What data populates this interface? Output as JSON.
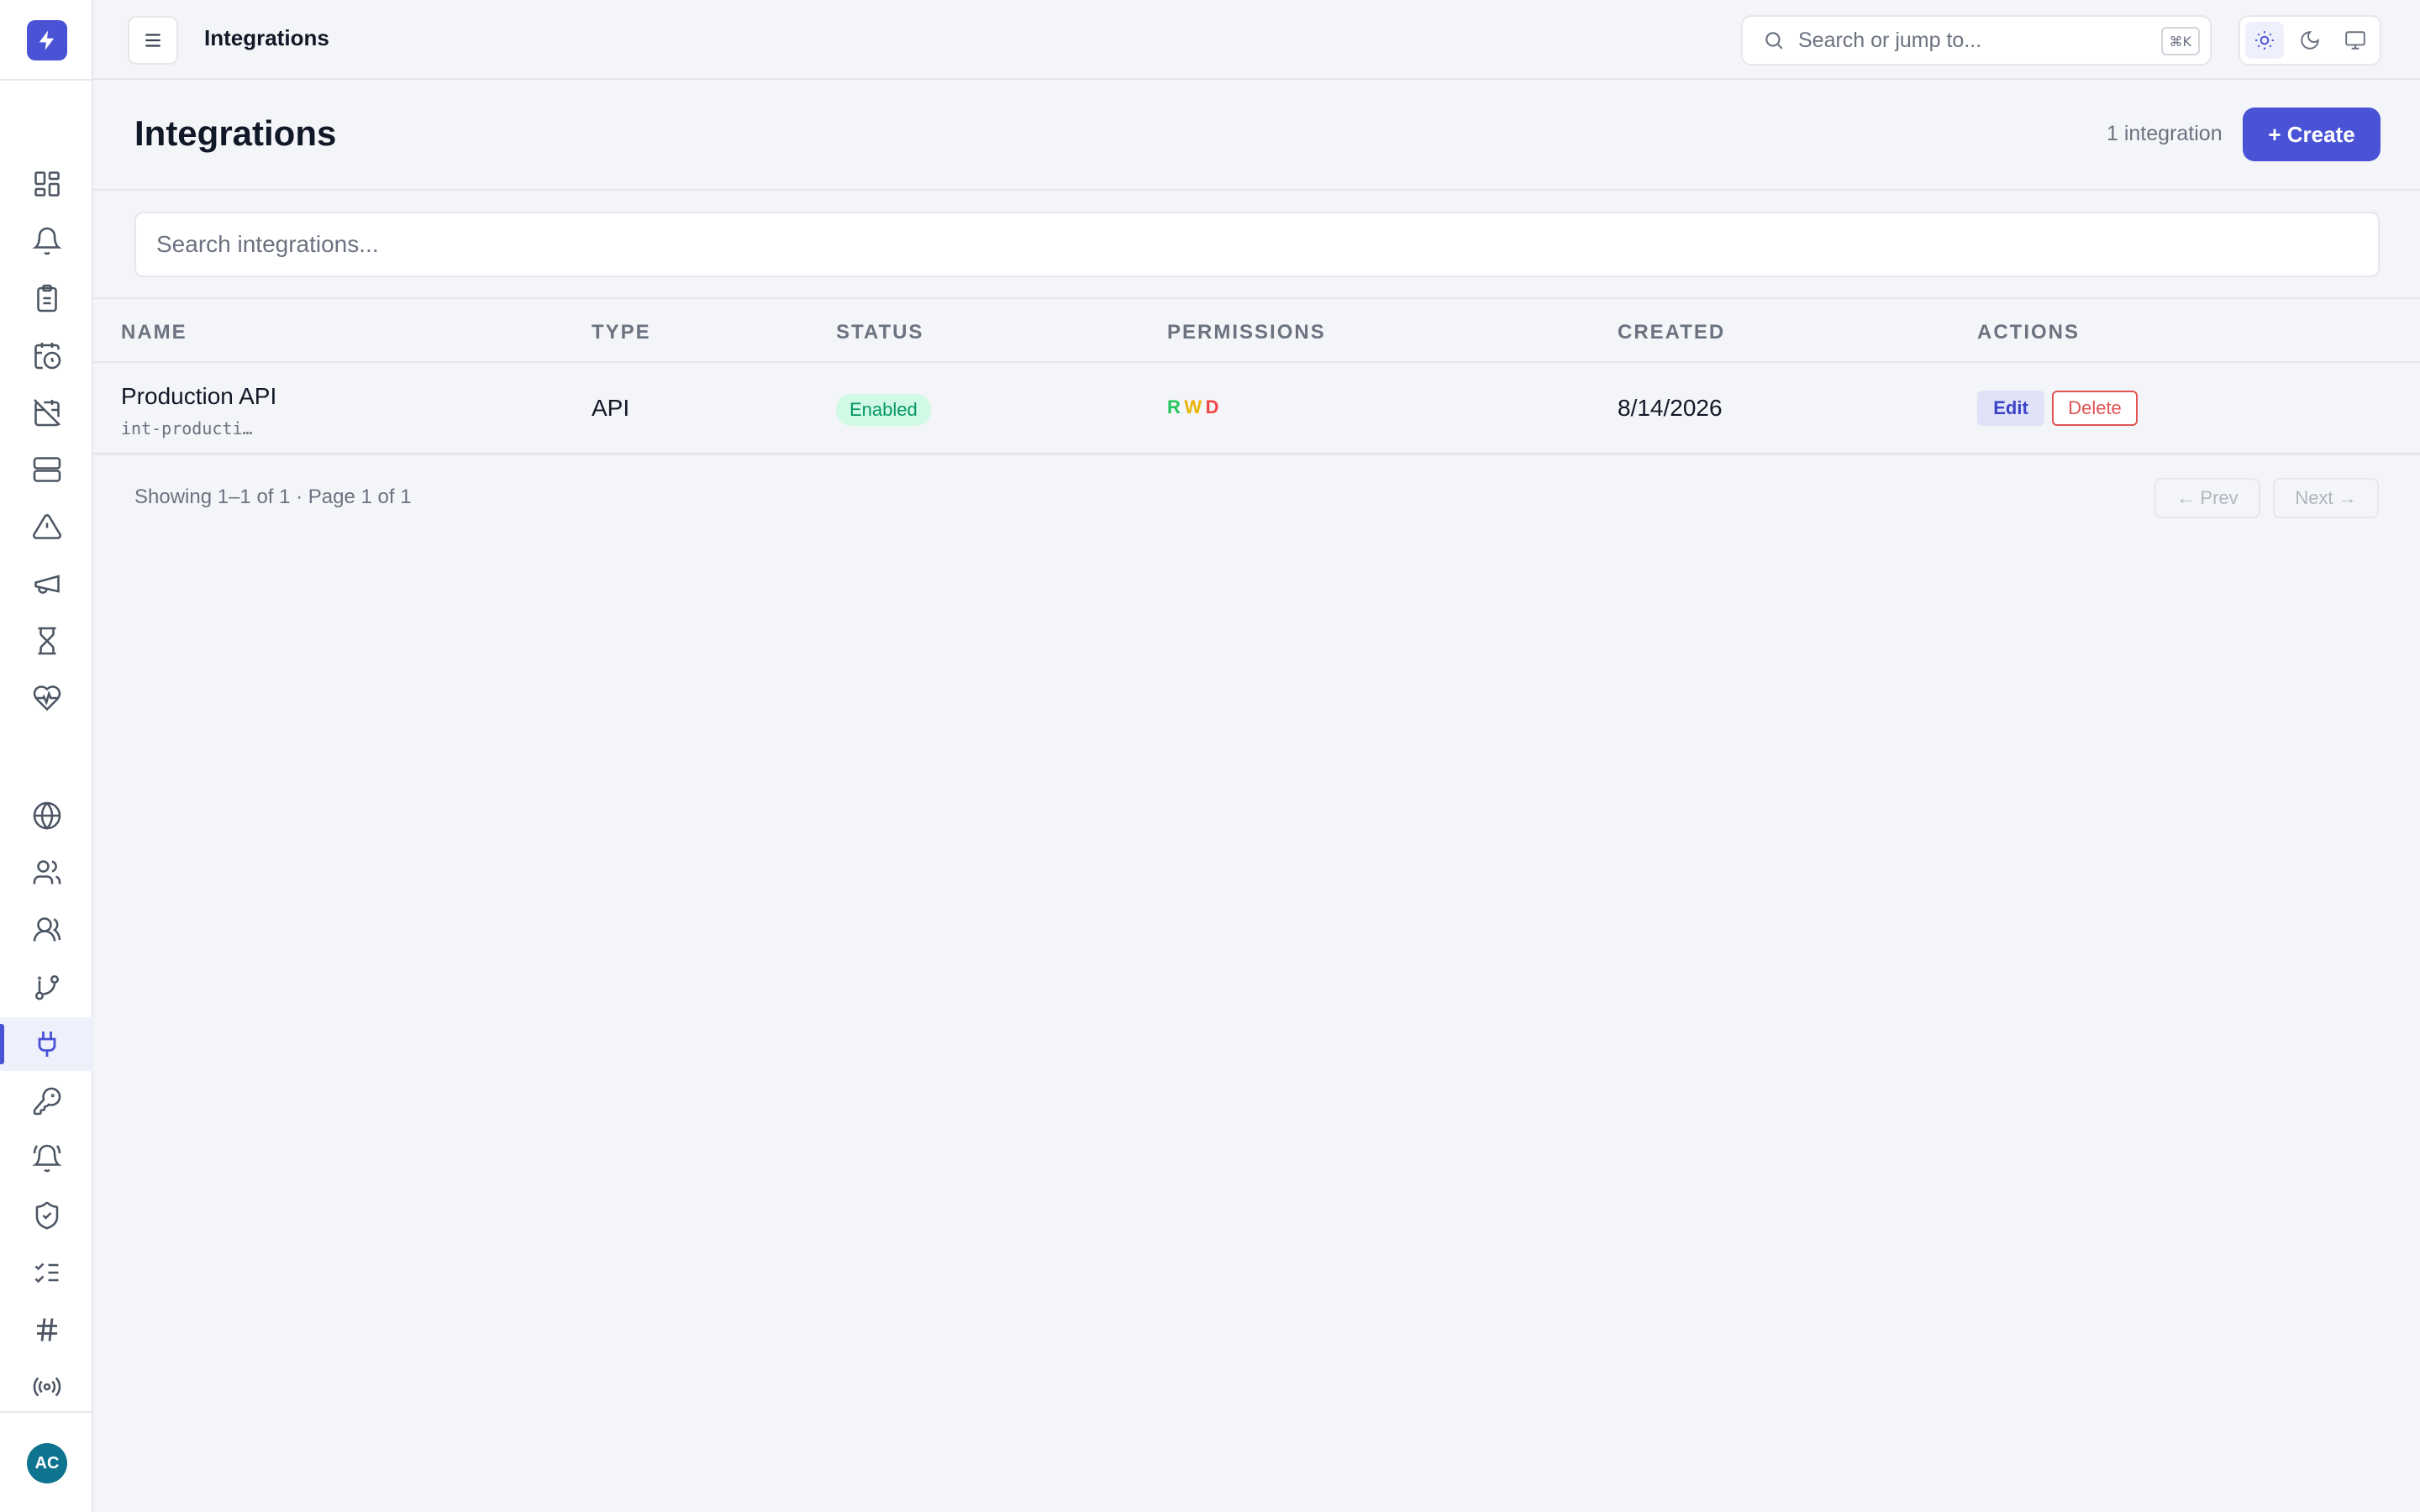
{
  "topbar": {
    "title": "Integrations",
    "search_placeholder": "Search or jump to...",
    "search_shortcut": "⌘K"
  },
  "sidebar": {
    "items": [
      {
        "icon": "dashboard-icon"
      },
      {
        "icon": "bell-icon"
      },
      {
        "icon": "clipboard-icon"
      },
      {
        "icon": "calendar-clock-icon"
      },
      {
        "icon": "calendar-off-icon"
      },
      {
        "icon": "server-icon"
      },
      {
        "icon": "alert-triangle-icon"
      },
      {
        "icon": "megaphone-icon"
      },
      {
        "icon": "hourglass-icon"
      },
      {
        "icon": "heart-pulse-icon"
      },
      {
        "icon": "globe-icon"
      },
      {
        "icon": "users-icon"
      },
      {
        "icon": "team-icon"
      },
      {
        "icon": "git-branch-icon"
      },
      {
        "icon": "plug-icon",
        "active": true
      },
      {
        "icon": "key-icon"
      },
      {
        "icon": "bell-ring-icon"
      },
      {
        "icon": "shield-check-icon"
      },
      {
        "icon": "list-checks-icon"
      },
      {
        "icon": "hash-icon"
      },
      {
        "icon": "broadcast-icon"
      }
    ],
    "avatar_initials": "AC"
  },
  "header": {
    "title": "Integrations",
    "count_text": "1 integration",
    "create_label": "+ Create"
  },
  "search": {
    "placeholder": "Search integrations..."
  },
  "table": {
    "columns": [
      "NAME",
      "TYPE",
      "STATUS",
      "PERMISSIONS",
      "CREATED",
      "ACTIONS"
    ],
    "rows": [
      {
        "name": "Production API",
        "id": "int-producti…",
        "type": "API",
        "status": "Enabled",
        "perm_r": "R",
        "perm_w": "W",
        "perm_d": "D",
        "created": "8/14/2026",
        "edit_label": "Edit",
        "delete_label": "Delete"
      }
    ]
  },
  "pagination": {
    "summary": "Showing 1–1 of 1 · Page 1 of 1",
    "prev_label": "← Prev",
    "next_label": "Next →"
  },
  "colors": {
    "accent": "#4a52d6",
    "enabled_green": "#059669",
    "perm_r": "#22c55e",
    "perm_w": "#eab308",
    "perm_d": "#ef4444",
    "delete_red": "#e05252"
  }
}
